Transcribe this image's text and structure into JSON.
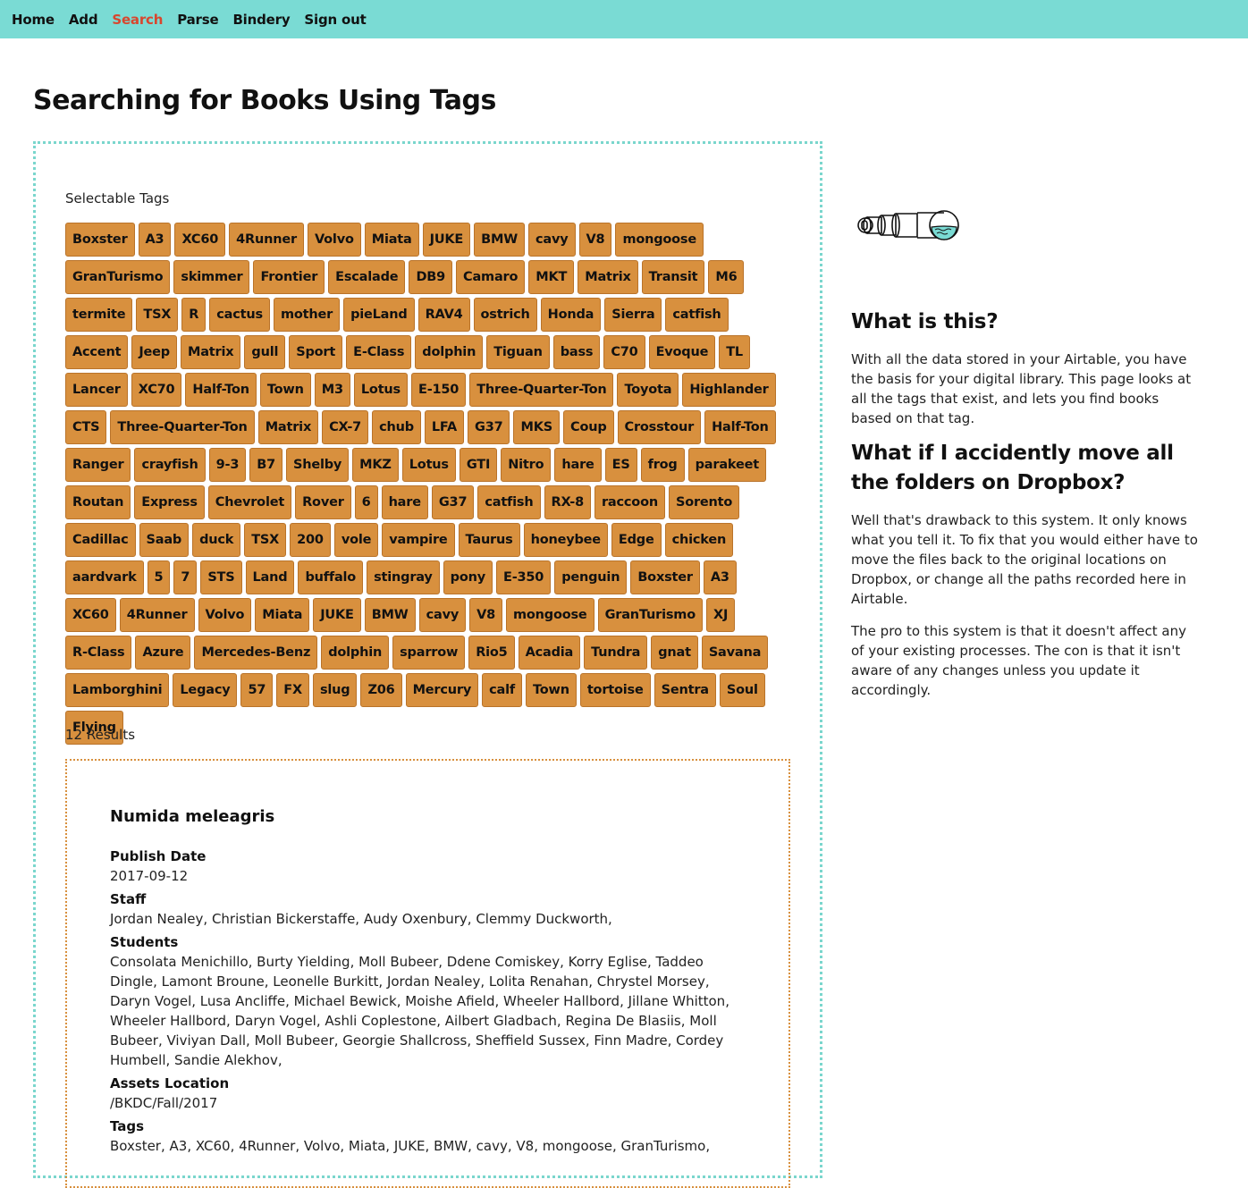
{
  "nav": {
    "items": [
      {
        "label": "Home"
      },
      {
        "label": "Add"
      },
      {
        "label": "Search"
      },
      {
        "label": "Parse"
      },
      {
        "label": "Bindery"
      },
      {
        "label": "Sign out"
      }
    ],
    "active_label": "Search",
    "active_color": "#d8462e",
    "background": "#7adbd4"
  },
  "page": {
    "title": "Searching for Books Using Tags"
  },
  "tags_section": {
    "label": "Selectable Tags",
    "tag_color": "#d8903e",
    "tags": [
      "Boxster",
      "A3",
      "XC60",
      "4Runner",
      "Volvo",
      "Miata",
      "JUKE",
      "BMW",
      "cavy",
      "V8",
      "mongoose",
      "GranTurismo",
      "skimmer",
      "Frontier",
      "Escalade",
      "DB9",
      "Camaro",
      "MKT",
      "Matrix",
      "Transit",
      "M6",
      "termite",
      "TSX",
      "R",
      "cactus",
      "mother",
      "pieLand",
      "RAV4",
      "ostrich",
      "Honda",
      "Sierra",
      "catfish",
      "Accent",
      "Jeep",
      "Matrix",
      "gull",
      "Sport",
      "E-Class",
      "dolphin",
      "Tiguan",
      "bass",
      "C70",
      "Evoque",
      "TL",
      "Lancer",
      "XC70",
      "Half-Ton",
      "Town",
      "M3",
      "Lotus",
      "E-150",
      "Three-Quarter-Ton",
      "Toyota",
      "Highlander",
      "CTS",
      "Three-Quarter-Ton",
      "Matrix",
      "CX-7",
      "chub",
      "LFA",
      "G37",
      "MKS",
      "Coup",
      "Crosstour",
      "Half-Ton",
      "Ranger",
      "crayfish",
      "9-3",
      "B7",
      "Shelby",
      "MKZ",
      "Lotus",
      "GTI",
      "Nitro",
      "hare",
      "ES",
      "frog",
      "parakeet",
      "Routan",
      "Express",
      "Chevrolet",
      "Rover",
      "6",
      "hare",
      "G37",
      "catfish",
      "RX-8",
      "raccoon",
      "Sorento",
      "Cadillac",
      "Saab",
      "duck",
      "TSX",
      "200",
      "vole",
      "vampire",
      "Taurus",
      "honeybee",
      "Edge",
      "chicken",
      "aardvark",
      "5",
      "7",
      "STS",
      "Land",
      "buffalo",
      "stingray",
      "pony",
      "E-350",
      "penguin",
      "Boxster",
      "A3",
      "XC60",
      "4Runner",
      "Volvo",
      "Miata",
      "JUKE",
      "BMW",
      "cavy",
      "V8",
      "mongoose",
      "GranTurismo",
      "XJ",
      "R-Class",
      "Azure",
      "Mercedes-Benz",
      "dolphin",
      "sparrow",
      "Rio5",
      "Acadia",
      "Tundra",
      "gnat",
      "Savana",
      "Lamborghini",
      "Legacy",
      "57",
      "FX",
      "slug",
      "Z06",
      "Mercury",
      "calf",
      "Town",
      "tortoise",
      "Sentra",
      "Soul",
      "Flying"
    ]
  },
  "results": {
    "count_label": "12 Results",
    "first": {
      "title": "Numida meleagris",
      "publish_date_label": "Publish Date",
      "publish_date": "2017-09-12",
      "staff_label": "Staff",
      "staff": "Jordan Nealey, Christian Bickerstaffe, Audy Oxenbury, Clemmy Duckworth,",
      "students_label": "Students",
      "students": "Consolata Menichillo, Burty Yielding, Moll Bubeer, Ddene Comiskey, Korry Eglise, Taddeo Dingle, Lamont Broune, Leonelle Burkitt, Jordan Nealey, Lolita Renahan, Chrystel Morsey, Daryn Vogel, Lusa Ancliffe, Michael Bewick, Moishe Afield, Wheeler Hallbord, Jillane Whitton, Wheeler Hallbord, Daryn Vogel, Ashli Coplestone, Ailbert Gladbach, Regina De Blasiis, Moll Bubeer, Viviyan Dall, Moll Bubeer, Georgie Shallcross, Sheffield Sussex, Finn Madre, Cordey Humbell, Sandie Alekhov,",
      "assets_label": "Assets Location",
      "assets": "/BKDC/Fall/2017",
      "tags_label": "Tags",
      "tags": "Boxster, A3, XC60, 4Runner, Volvo, Miata, JUKE, BMW, cavy, V8, mongoose, GranTurismo,"
    }
  },
  "sidebar": {
    "illustration_icon": "telescope-icon",
    "heading1": "What is this?",
    "para1": "With all the data stored in your Airtable, you have the basis for your digital library. This page looks at all the tags that exist, and lets you find books based on that tag.",
    "heading2": "What if I accidently move all the folders on Dropbox?",
    "para2": "Well that's drawback to this system. It only knows what you tell it. To fix that you would either have to move the files back to the original locations on Dropbox, or change all the paths recorded here in Airtable.",
    "para3": "The pro to this system is that it doesn't affect any of your existing processes. The con is that it isn't aware of any changes unless you update it accordingly."
  }
}
